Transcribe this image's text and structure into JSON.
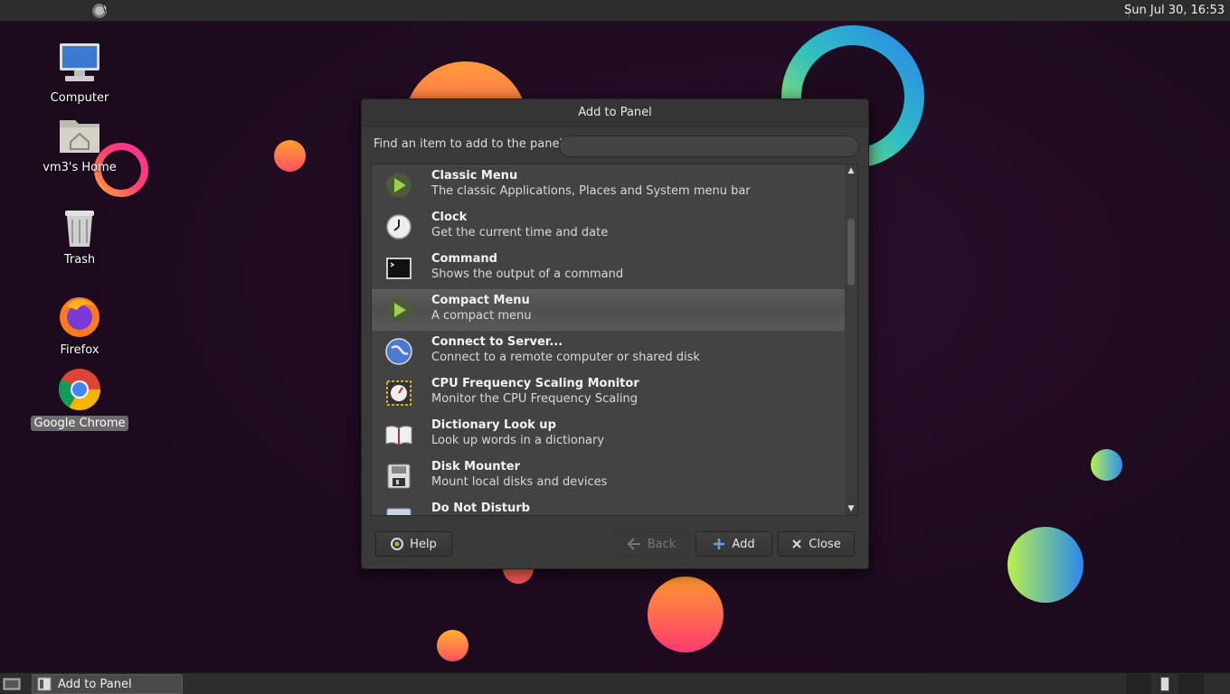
{
  "top_panel": {
    "clock": "Sun Jul 30, 16:53",
    "menu_icon": "gnome-foot-icon"
  },
  "desktop": {
    "icons": [
      {
        "label": "Computer",
        "icon": "computer-icon"
      },
      {
        "label": "vm3's Home",
        "icon": "home-folder-icon"
      },
      {
        "label": "Trash",
        "icon": "trash-icon"
      },
      {
        "label": "Firefox",
        "icon": "firefox-icon"
      },
      {
        "label": "Google Chrome",
        "icon": "chrome-icon"
      }
    ]
  },
  "dialog": {
    "title": "Add to Panel",
    "find_label": "Find an item to add to the panel:",
    "search_value": "",
    "items": [
      {
        "name": "Classic Menu",
        "desc": "The classic Applications, Places and System menu bar",
        "icon": "menu-icon"
      },
      {
        "name": "Clock",
        "desc": "Get the current time and date",
        "icon": "clock-icon"
      },
      {
        "name": "Command",
        "desc": "Shows the output of a command",
        "icon": "terminal-icon"
      },
      {
        "name": "Compact Menu",
        "desc": "A compact menu",
        "icon": "menu-icon"
      },
      {
        "name": "Connect to Server...",
        "desc": "Connect to a remote computer or shared disk",
        "icon": "globe-icon"
      },
      {
        "name": "CPU Frequency Scaling Monitor",
        "desc": "Monitor the CPU Frequency Scaling",
        "icon": "cpu-gauge-icon"
      },
      {
        "name": "Dictionary Look up",
        "desc": "Look up words in a dictionary",
        "icon": "book-icon"
      },
      {
        "name": "Disk Mounter",
        "desc": "Mount local disks and devices",
        "icon": "floppy-icon"
      },
      {
        "name": "Do Not Disturb",
        "desc": "",
        "icon": "notification-icon"
      }
    ],
    "buttons": {
      "help": "Help",
      "back": "Back",
      "add": "Add",
      "close": "Close"
    }
  },
  "bottom_panel": {
    "task_label": "Add to Panel"
  }
}
